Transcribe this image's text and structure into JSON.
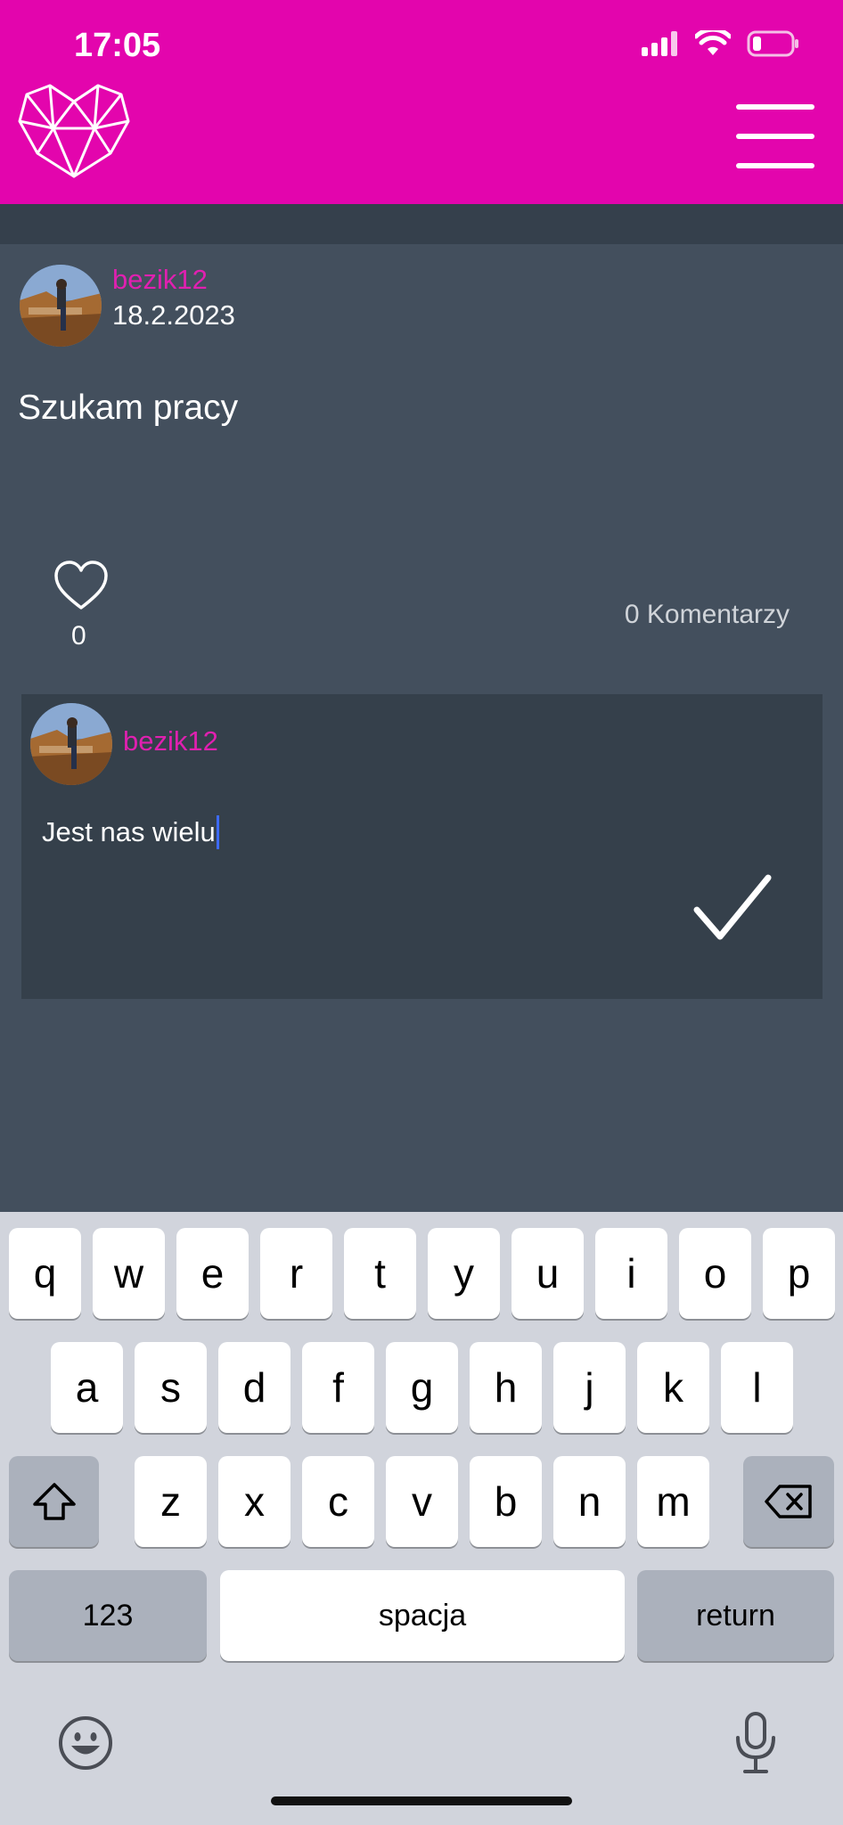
{
  "status_bar": {
    "time": "17:05"
  },
  "colors": {
    "brand": "#e305ad",
    "username": "#e020b0",
    "background": "#434f5d",
    "comment_box": "#35404b"
  },
  "post": {
    "username": "bezik12",
    "date": "18.2.2023",
    "text": "Szukam pracy",
    "likes": "0",
    "comments_label": "0 Komentarzy"
  },
  "comment_form": {
    "username": "bezik12",
    "input_value": "Jest nas wielu"
  },
  "keyboard": {
    "row1": [
      "q",
      "w",
      "e",
      "r",
      "t",
      "y",
      "u",
      "i",
      "o",
      "p"
    ],
    "row2": [
      "a",
      "s",
      "d",
      "f",
      "g",
      "h",
      "j",
      "k",
      "l"
    ],
    "row3": [
      "z",
      "x",
      "c",
      "v",
      "b",
      "n",
      "m"
    ],
    "numbers_key": "123",
    "space_key": "spacja",
    "return_key": "return"
  },
  "icons": [
    "signal-icon",
    "wifi-icon",
    "battery-icon",
    "logo-heart-icon",
    "menu-icon",
    "heart-icon",
    "checkmark-icon",
    "shift-icon",
    "backspace-icon",
    "emoji-icon",
    "microphone-icon"
  ]
}
